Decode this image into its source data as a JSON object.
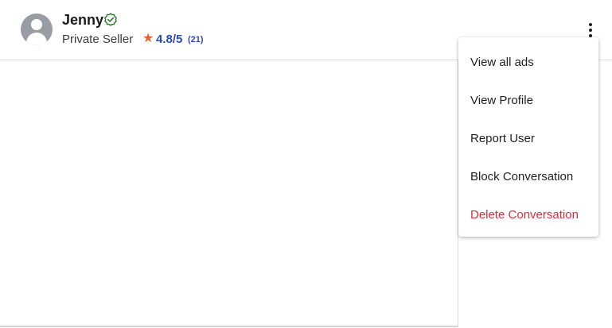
{
  "header": {
    "user_name": "Jenny",
    "verified_icon": "verified-check-icon",
    "seller_type": "Private Seller",
    "rating_icon": "star-icon",
    "rating": "4.8/5",
    "rating_count": "(21)",
    "more_icon": "more-vertical-icon"
  },
  "menu": {
    "items": [
      {
        "label": "View all ads"
      },
      {
        "label": "View Profile"
      },
      {
        "label": "Report User"
      },
      {
        "label": "Block Conversation"
      },
      {
        "label": "Delete Conversation"
      }
    ]
  },
  "colors": {
    "accent_blue": "#2c4bb8",
    "star_orange": "#e8602c",
    "verified_green": "#2e7d32",
    "danger_red": "#d2303c",
    "avatar_gray": "#9a9ca3"
  }
}
